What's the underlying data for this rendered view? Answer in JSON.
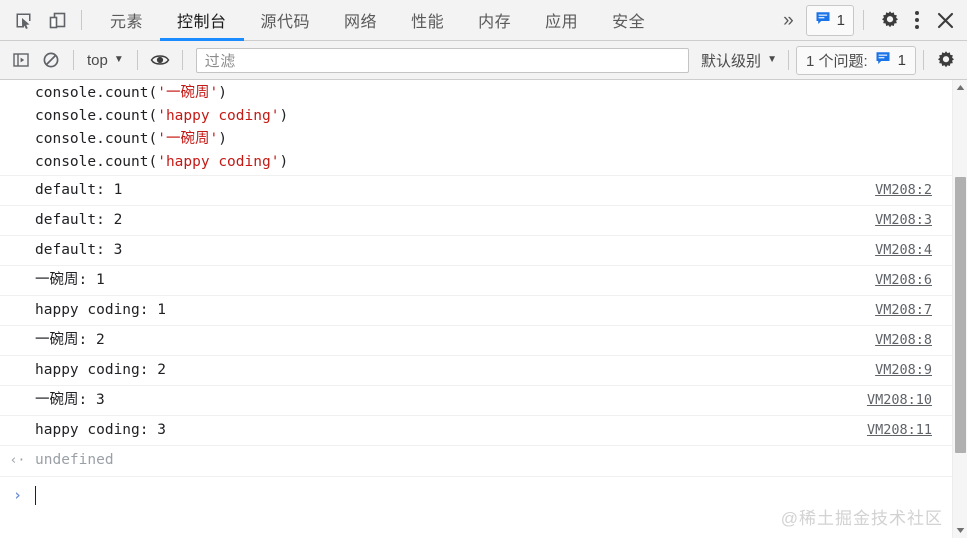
{
  "toolbar": {
    "inspect_icon": "inspect-element-icon",
    "device_icon": "device-toolbar-icon",
    "tabs": [
      {
        "label": "元素",
        "name": "elements",
        "active": false
      },
      {
        "label": "控制台",
        "name": "console",
        "active": true
      },
      {
        "label": "源代码",
        "name": "sources",
        "active": false
      },
      {
        "label": "网络",
        "name": "network",
        "active": false
      },
      {
        "label": "性能",
        "name": "performance",
        "active": false
      },
      {
        "label": "内存",
        "name": "memory",
        "active": false
      },
      {
        "label": "应用",
        "name": "application",
        "active": false
      },
      {
        "label": "安全",
        "name": "security",
        "active": false
      }
    ],
    "more_tabs_label": "»",
    "issues_count": "1",
    "issues_icon": "message-bubble-icon",
    "settings_icon": "gear-icon",
    "more_options_icon": "kebab-menu-icon",
    "close_icon": "close-icon",
    "accent_color": "#1a8cff",
    "bar_background": "#f3f3f3"
  },
  "filterbar": {
    "sidebar_toggle_icon": "console-sidebar-icon",
    "clear_icon": "clear-console-icon",
    "context_label": "top",
    "context_caret": "▼",
    "eye_icon": "live-expression-eye-icon",
    "filter_placeholder": "过滤",
    "filter_value": "",
    "levels_label": "默认级别",
    "levels_caret": "▼",
    "issues_label": "1 个问题:",
    "issues_icon": "message-bubble-icon",
    "issues_count": "1",
    "settings_icon": "gear-icon"
  },
  "console": {
    "input_echo": [
      {
        "pre": "console.count(",
        "str": "'一碗周'",
        "post": ")"
      },
      {
        "pre": "console.count(",
        "str": "'happy coding'",
        "post": ")"
      },
      {
        "pre": "console.count(",
        "str": "'一碗周'",
        "post": ")"
      },
      {
        "pre": "console.count(",
        "str": "'happy coding'",
        "post": ")"
      }
    ],
    "logs": [
      {
        "message": "default: 1",
        "source": "VM208:2"
      },
      {
        "message": "default: 2",
        "source": "VM208:3"
      },
      {
        "message": "default: 3",
        "source": "VM208:4"
      },
      {
        "message": "一碗周: 1",
        "source": "VM208:6"
      },
      {
        "message": "happy coding: 1",
        "source": "VM208:7"
      },
      {
        "message": "一碗周: 2",
        "source": "VM208:8"
      },
      {
        "message": "happy coding: 2",
        "source": "VM208:9"
      },
      {
        "message": "一碗周: 3",
        "source": "VM208:10"
      },
      {
        "message": "happy coding: 3",
        "source": "VM208:11"
      }
    ],
    "result": {
      "arrow": "‹·",
      "value": "undefined"
    },
    "prompt": {
      "arrow": "›",
      "value": ""
    }
  },
  "watermark": "@稀土掘金技术社区",
  "scrollbar": {
    "up_arrow": "▲",
    "down_arrow": "▼"
  }
}
